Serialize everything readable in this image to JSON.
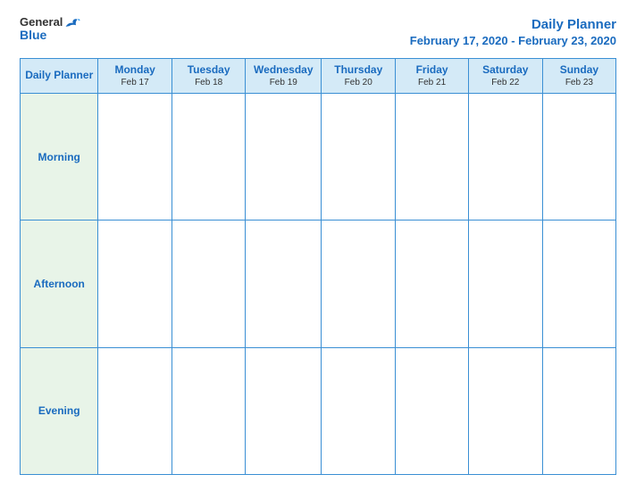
{
  "header": {
    "logo_general": "General",
    "logo_blue": "Blue",
    "title": "Daily Planner",
    "date_range": "February 17, 2020 - February 23, 2020"
  },
  "table": {
    "header_label": "Daily Planner",
    "days": [
      {
        "name": "Monday",
        "date": "Feb 17"
      },
      {
        "name": "Tuesday",
        "date": "Feb 18"
      },
      {
        "name": "Wednesday",
        "date": "Feb 19"
      },
      {
        "name": "Thursday",
        "date": "Feb 20"
      },
      {
        "name": "Friday",
        "date": "Feb 21"
      },
      {
        "name": "Saturday",
        "date": "Feb 22"
      },
      {
        "name": "Sunday",
        "date": "Feb 23"
      }
    ],
    "rows": [
      {
        "label": "Morning"
      },
      {
        "label": "Afternoon"
      },
      {
        "label": "Evening"
      }
    ]
  }
}
